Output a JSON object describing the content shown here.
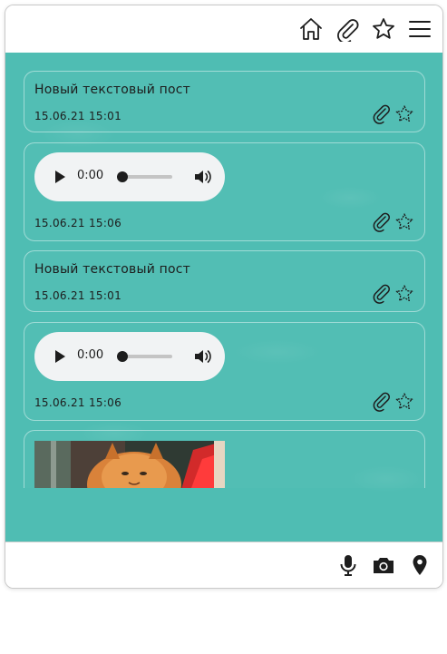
{
  "posts": [
    {
      "type": "text",
      "text": "Новый текстовый пост",
      "date": "15.06.21 15:01"
    },
    {
      "type": "audio",
      "time": "0:00",
      "date": "15.06.21 15:06"
    },
    {
      "type": "text",
      "text": "Новый текстовый пост",
      "date": "15.06.21 15:01"
    },
    {
      "type": "audio",
      "time": "0:00",
      "date": "15.06.21 15:06"
    },
    {
      "type": "image"
    }
  ],
  "icons": {
    "header": [
      "home-icon",
      "paperclip-icon",
      "star-icon",
      "menu-icon"
    ],
    "post_actions": [
      "pin-icon",
      "favorite-star-icon"
    ],
    "footer": [
      "microphone-icon",
      "camera-icon",
      "location-pin-icon"
    ]
  },
  "colors": {
    "feed_background": "#4fbdb3",
    "audio_player": "#f1f3f4",
    "icon": "#1d1d1d"
  }
}
